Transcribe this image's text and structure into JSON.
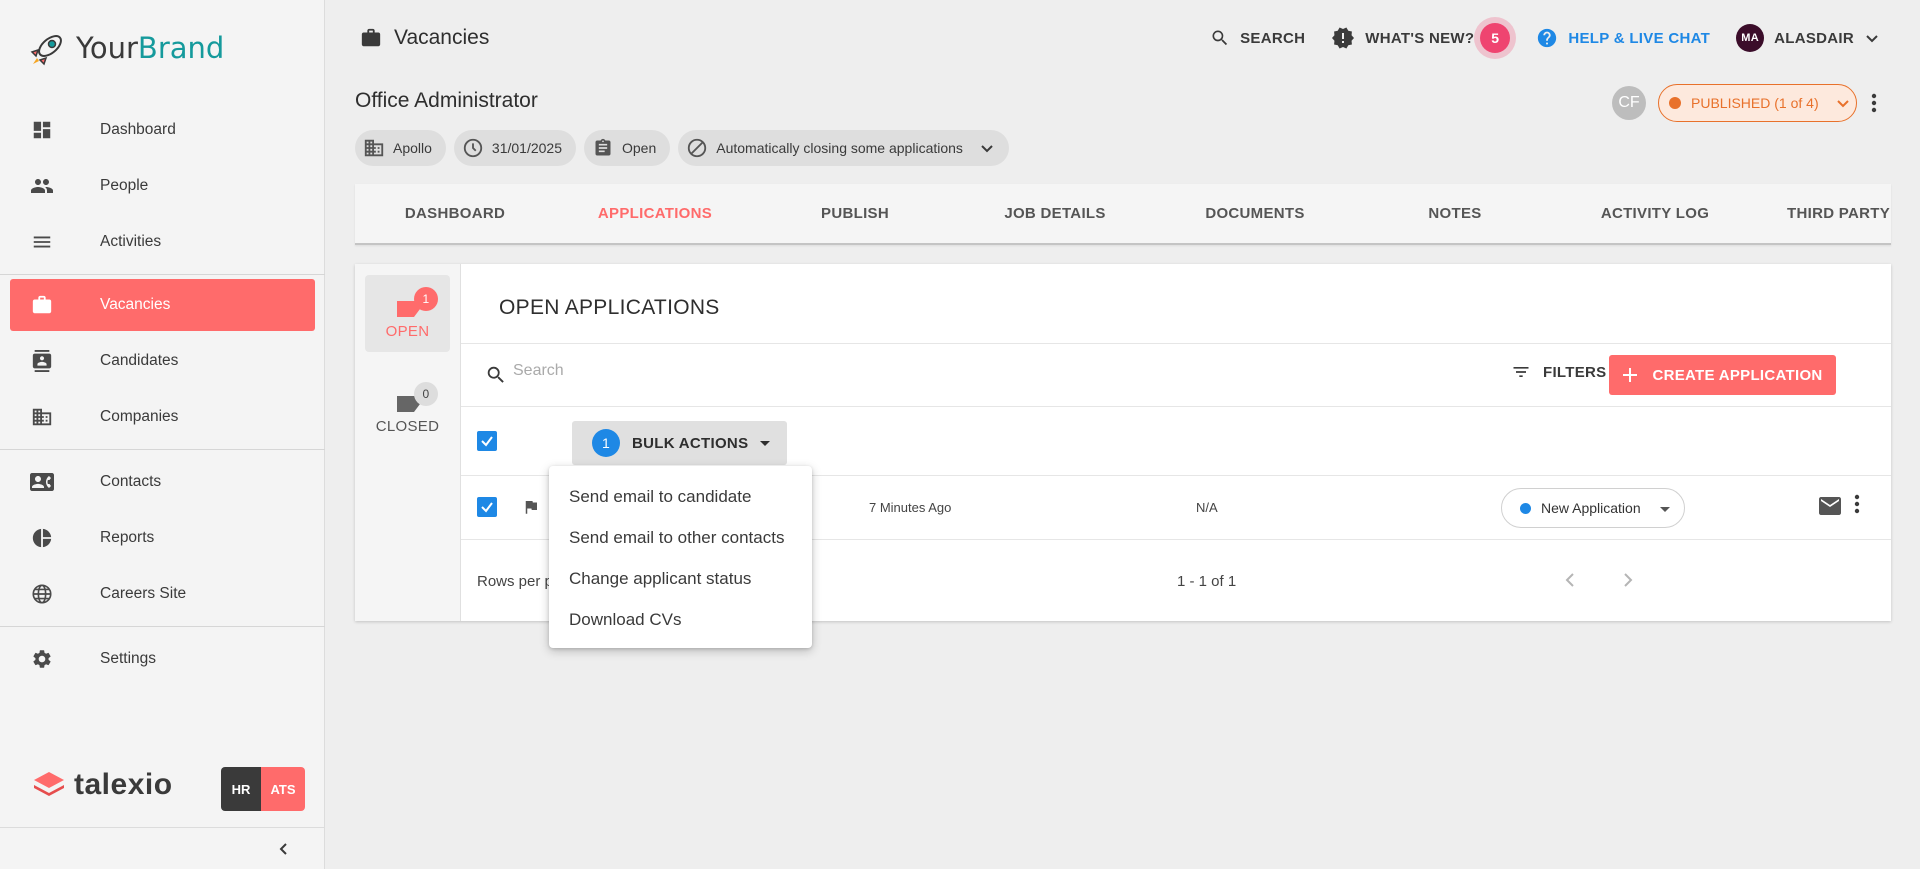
{
  "brand": {
    "prefix": "Your",
    "name": "Brand"
  },
  "sidebar": {
    "items": [
      {
        "label": "Dashboard"
      },
      {
        "label": "People"
      },
      {
        "label": "Activities"
      },
      {
        "label": "Vacancies"
      },
      {
        "label": "Candidates"
      },
      {
        "label": "Companies"
      },
      {
        "label": "Contacts"
      },
      {
        "label": "Reports"
      },
      {
        "label": "Careers Site"
      },
      {
        "label": "Settings"
      }
    ],
    "footer_brand": "talexio",
    "module_hr": "HR",
    "module_ats": "ATS"
  },
  "header": {
    "section_title": "Vacancies",
    "search_label": "SEARCH",
    "whats_new_label": "WHAT'S NEW?",
    "notification_count": "5",
    "help_label": "HELP & LIVE CHAT",
    "user_initials": "MA",
    "user_name": "ALASDAIR"
  },
  "vacancy": {
    "title": "Office Administrator",
    "chips": {
      "company": "Apollo",
      "date": "31/01/2025",
      "state": "Open",
      "auto_close": "Automatically closing some applications"
    },
    "collaborator_initials": "CF",
    "publish_status": "PUBLISHED (1 of 4)"
  },
  "tabs": [
    {
      "label": "DASHBOARD"
    },
    {
      "label": "APPLICATIONS"
    },
    {
      "label": "PUBLISH"
    },
    {
      "label": "JOB DETAILS"
    },
    {
      "label": "DOCUMENTS"
    },
    {
      "label": "NOTES"
    },
    {
      "label": "ACTIVITY LOG"
    },
    {
      "label": "THIRD PARTY SO"
    }
  ],
  "applications": {
    "open_label": "OPEN",
    "open_count": "1",
    "closed_label": "CLOSED",
    "closed_count": "0",
    "title": "OPEN APPLICATIONS",
    "search_placeholder": "Search",
    "filters_label": "FILTERS",
    "create_label": "CREATE APPLICATION",
    "bulk_count": "1",
    "bulk_label": "BULK ACTIONS",
    "row": {
      "time": "7 Minutes Ago",
      "score": "N/A",
      "status": "New Application"
    },
    "rows_per_page_label": "Rows per p",
    "range_label": "1 - 1 of 1"
  },
  "bulk_menu": {
    "items": [
      {
        "label": "Send email to candidate"
      },
      {
        "label": "Send email to other contacts"
      },
      {
        "label": "Change applicant status"
      },
      {
        "label": "Download CVs"
      }
    ]
  },
  "colors": {
    "accent": "#ff6b6b",
    "brand_teal": "#159a9c",
    "link_blue": "#1e88e5",
    "published_orange": "#e8712b",
    "badge_pink": "#ef4470"
  }
}
